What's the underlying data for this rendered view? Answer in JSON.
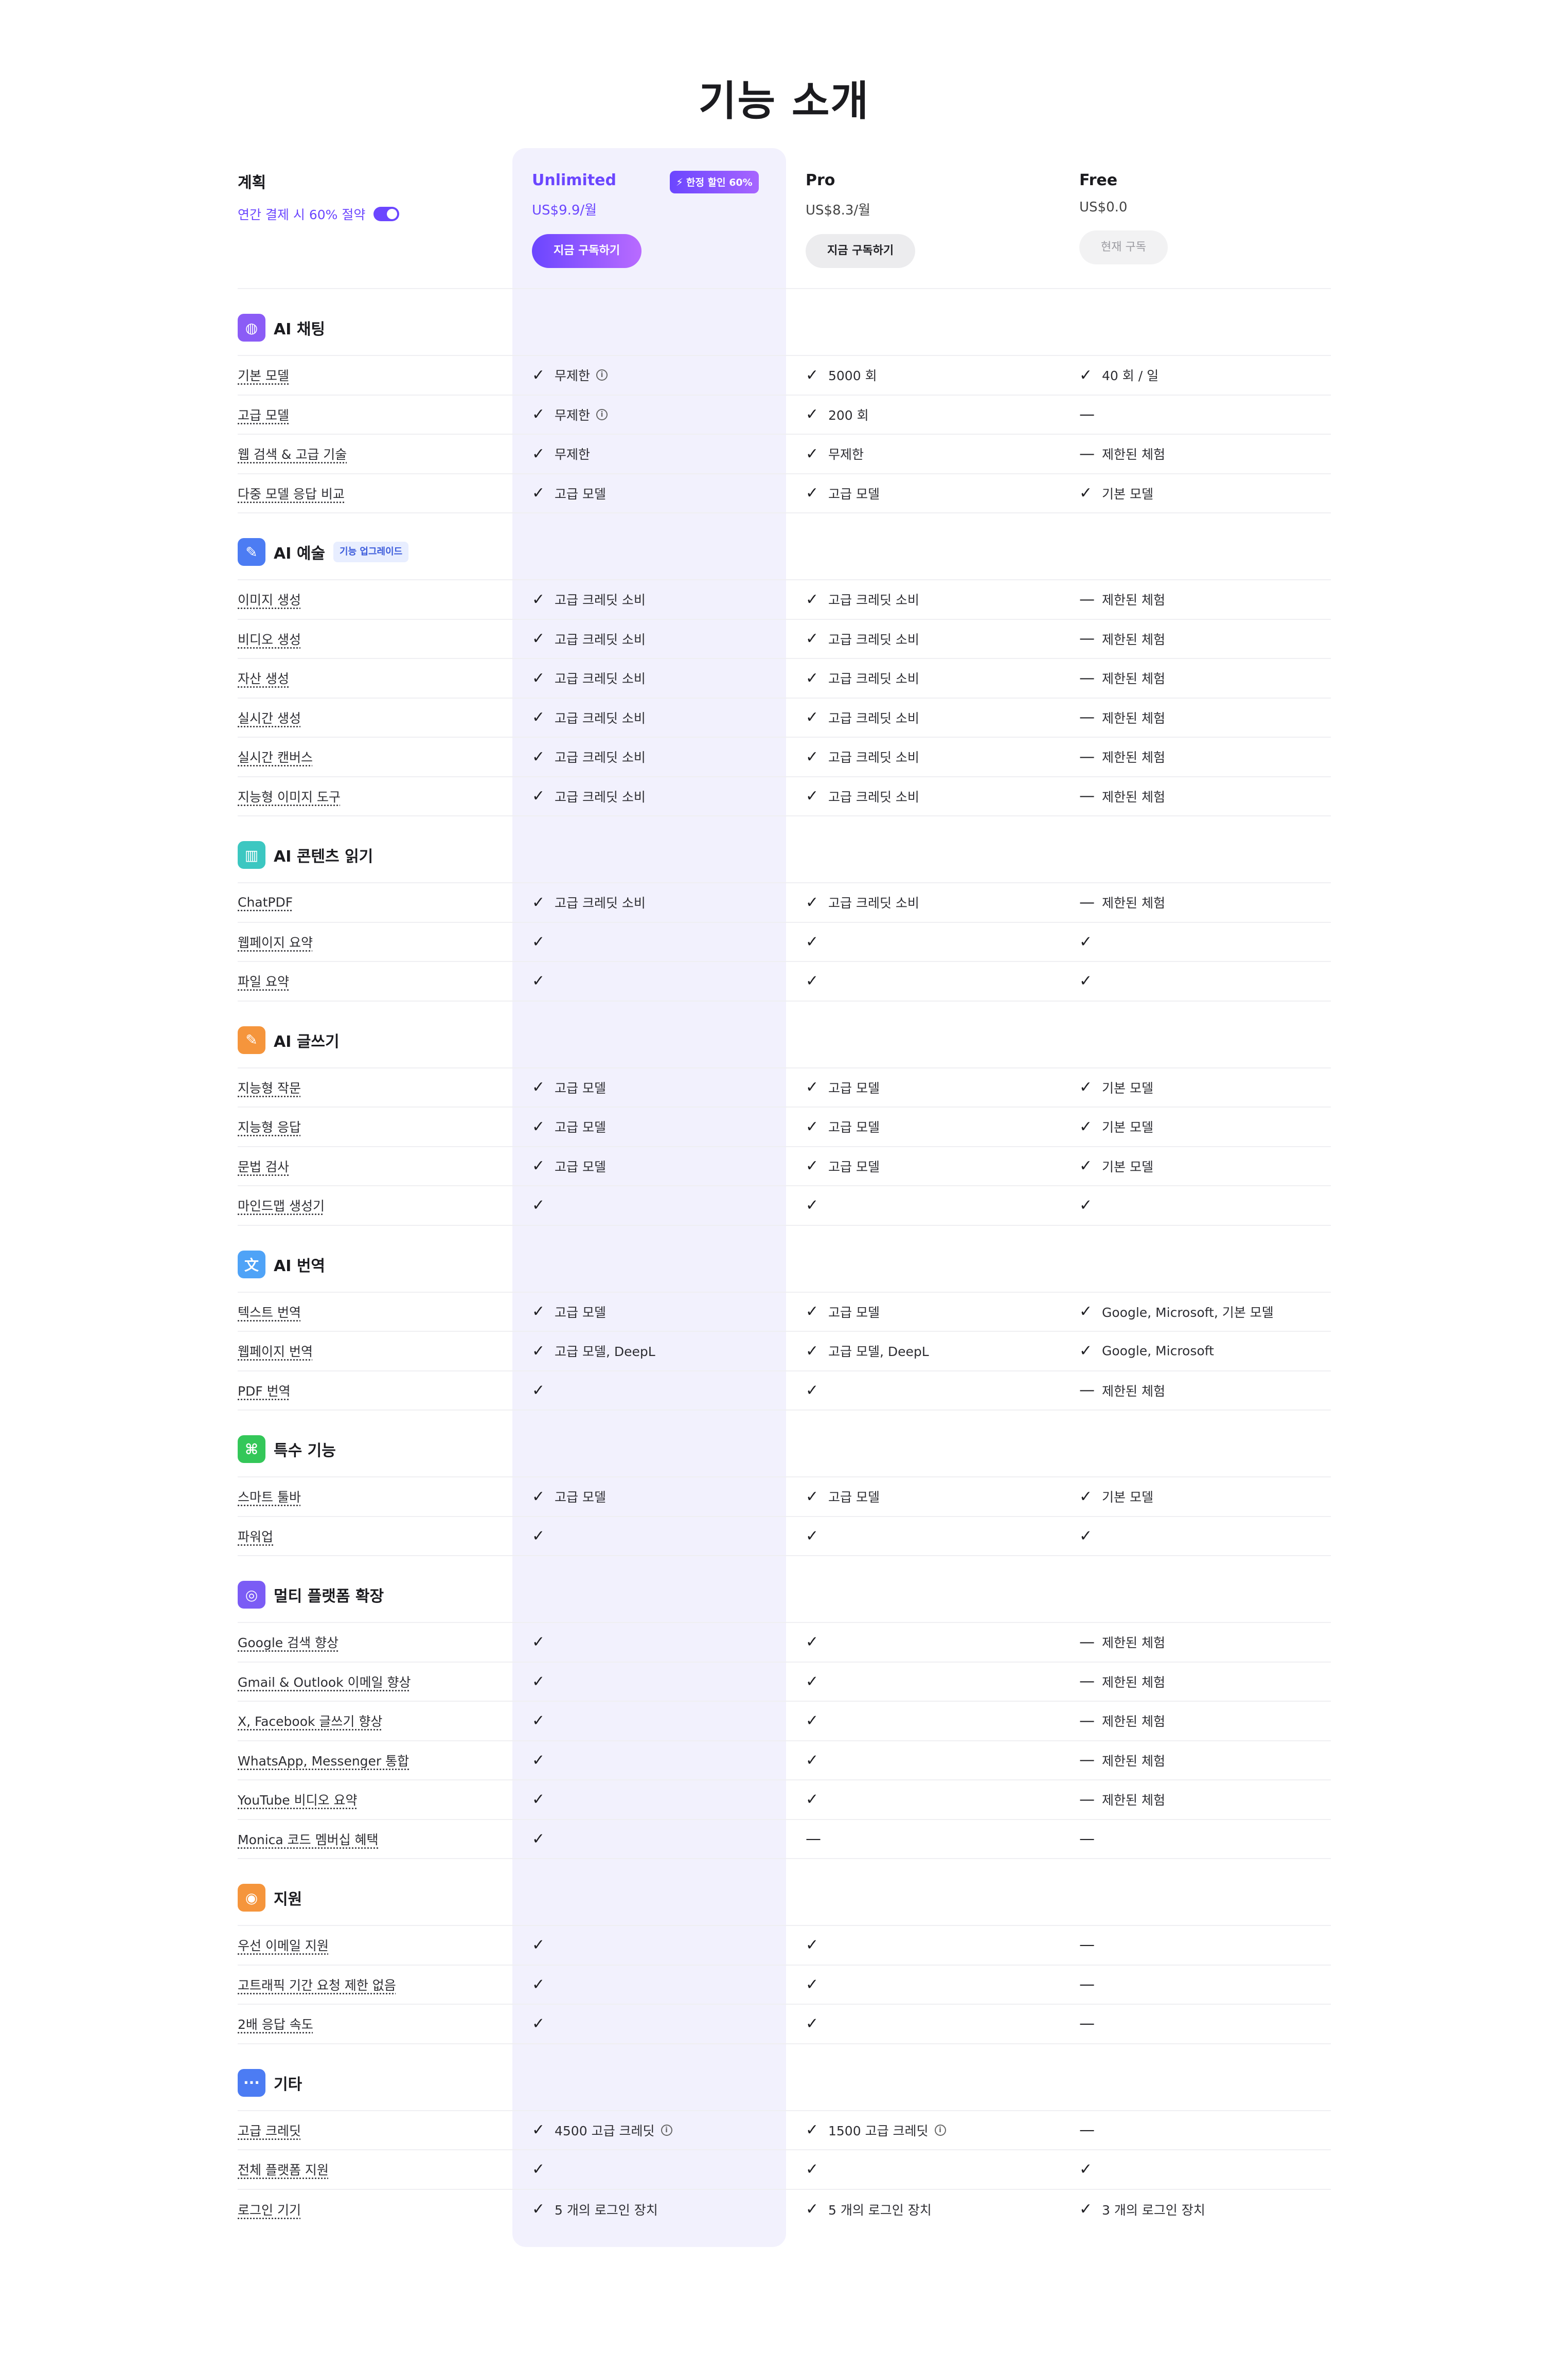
{
  "title": "기능 소개",
  "plans_header": {
    "label": "계획",
    "toggle_text": "연간 결제 시 60% 절약"
  },
  "columns": [
    {
      "name": "Unlimited",
      "price": "US$9.9/월",
      "button": "지금 구독하기",
      "badge": "한정 할인 60%"
    },
    {
      "name": "Pro",
      "price": "US$8.3/월",
      "button": "지금 구독하기"
    },
    {
      "name": "Free",
      "price": "US$0.0",
      "button": "현재 구독"
    }
  ],
  "colors": {
    "accent": "#6b46ff",
    "highlight_bg": "#f2f1fd"
  },
  "sections": [
    {
      "title": "AI 채팅",
      "icon": "chat-icon",
      "icon_color": "#8b5cf6",
      "icon_glyph": "◍",
      "rows": [
        {
          "feature": "기본 모델",
          "cells": [
            {
              "mark": "check",
              "text": "무제한",
              "info": true
            },
            {
              "mark": "check",
              "text": "5000 회"
            },
            {
              "mark": "check",
              "text": "40 회 / 일"
            }
          ]
        },
        {
          "feature": "고급 모델",
          "cells": [
            {
              "mark": "check",
              "text": "무제한",
              "info": true
            },
            {
              "mark": "check",
              "text": "200 회"
            },
            {
              "mark": "dash",
              "text": ""
            }
          ]
        },
        {
          "feature": "웹 검색 & 고급 기술",
          "cells": [
            {
              "mark": "check",
              "text": "무제한"
            },
            {
              "mark": "check",
              "text": "무제한"
            },
            {
              "mark": "dash",
              "text": "제한된 체험"
            }
          ]
        },
        {
          "feature": "다중 모델 응답 비교",
          "cells": [
            {
              "mark": "check",
              "text": "고급 모델"
            },
            {
              "mark": "check",
              "text": "고급 모델"
            },
            {
              "mark": "check",
              "text": "기본 모델"
            }
          ]
        }
      ]
    },
    {
      "title": "AI 예술",
      "icon": "brush-icon",
      "icon_color": "#4c7cf3",
      "icon_glyph": "✎",
      "badge": "기능 업그레이드",
      "rows": [
        {
          "feature": "이미지 생성",
          "cells": [
            {
              "mark": "check",
              "text": "고급 크레딧 소비"
            },
            {
              "mark": "check",
              "text": "고급 크레딧 소비"
            },
            {
              "mark": "dash",
              "text": "제한된 체험"
            }
          ]
        },
        {
          "feature": "비디오 생성",
          "cells": [
            {
              "mark": "check",
              "text": "고급 크레딧 소비"
            },
            {
              "mark": "check",
              "text": "고급 크레딧 소비"
            },
            {
              "mark": "dash",
              "text": "제한된 체험"
            }
          ]
        },
        {
          "feature": "자산 생성",
          "cells": [
            {
              "mark": "check",
              "text": "고급 크레딧 소비"
            },
            {
              "mark": "check",
              "text": "고급 크레딧 소비"
            },
            {
              "mark": "dash",
              "text": "제한된 체험"
            }
          ]
        },
        {
          "feature": "실시간 생성",
          "cells": [
            {
              "mark": "check",
              "text": "고급 크레딧 소비"
            },
            {
              "mark": "check",
              "text": "고급 크레딧 소비"
            },
            {
              "mark": "dash",
              "text": "제한된 체험"
            }
          ]
        },
        {
          "feature": "실시간 캔버스",
          "cells": [
            {
              "mark": "check",
              "text": "고급 크레딧 소비"
            },
            {
              "mark": "check",
              "text": "고급 크레딧 소비"
            },
            {
              "mark": "dash",
              "text": "제한된 체험"
            }
          ]
        },
        {
          "feature": "지능형 이미지 도구",
          "cells": [
            {
              "mark": "check",
              "text": "고급 크레딧 소비"
            },
            {
              "mark": "check",
              "text": "고급 크레딧 소비"
            },
            {
              "mark": "dash",
              "text": "제한된 체험"
            }
          ]
        }
      ]
    },
    {
      "title": "AI 콘텐츠 읽기",
      "icon": "book-icon",
      "icon_color": "#3cc7c1",
      "icon_glyph": "▥",
      "rows": [
        {
          "feature": "ChatPDF",
          "cells": [
            {
              "mark": "check",
              "text": "고급 크레딧 소비"
            },
            {
              "mark": "check",
              "text": "고급 크레딧 소비"
            },
            {
              "mark": "dash",
              "text": "제한된 체험"
            }
          ]
        },
        {
          "feature": "웹페이지 요약",
          "cells": [
            {
              "mark": "check",
              "text": ""
            },
            {
              "mark": "check",
              "text": ""
            },
            {
              "mark": "check",
              "text": ""
            }
          ]
        },
        {
          "feature": "파일 요약",
          "cells": [
            {
              "mark": "check",
              "text": ""
            },
            {
              "mark": "check",
              "text": ""
            },
            {
              "mark": "check",
              "text": ""
            }
          ]
        }
      ]
    },
    {
      "title": "AI 글쓰기",
      "icon": "pen-icon",
      "icon_color": "#f5953c",
      "icon_glyph": "✎",
      "rows": [
        {
          "feature": "지능형 작문",
          "cells": [
            {
              "mark": "check",
              "text": "고급 모델"
            },
            {
              "mark": "check",
              "text": "고급 모델"
            },
            {
              "mark": "check",
              "text": "기본 모델"
            }
          ]
        },
        {
          "feature": "지능형 응답",
          "cells": [
            {
              "mark": "check",
              "text": "고급 모델"
            },
            {
              "mark": "check",
              "text": "고급 모델"
            },
            {
              "mark": "check",
              "text": "기본 모델"
            }
          ]
        },
        {
          "feature": "문법 검사",
          "cells": [
            {
              "mark": "check",
              "text": "고급 모델"
            },
            {
              "mark": "check",
              "text": "고급 모델"
            },
            {
              "mark": "check",
              "text": "기본 모델"
            }
          ]
        },
        {
          "feature": "마인드맵 생성기",
          "cells": [
            {
              "mark": "check",
              "text": ""
            },
            {
              "mark": "check",
              "text": ""
            },
            {
              "mark": "check",
              "text": ""
            }
          ]
        }
      ]
    },
    {
      "title": "AI 번역",
      "icon": "translate-icon",
      "icon_color": "#4fa3f7",
      "icon_glyph": "文",
      "rows": [
        {
          "feature": "텍스트 번역",
          "cells": [
            {
              "mark": "check",
              "text": "고급 모델"
            },
            {
              "mark": "check",
              "text": "고급 모델"
            },
            {
              "mark": "check",
              "text": "Google, Microsoft, 기본 모델"
            }
          ]
        },
        {
          "feature": "웹페이지 번역",
          "cells": [
            {
              "mark": "check",
              "text": "고급 모델, DeepL"
            },
            {
              "mark": "check",
              "text": "고급 모델, DeepL"
            },
            {
              "mark": "check",
              "text": "Google, Microsoft"
            }
          ]
        },
        {
          "feature": "PDF 번역",
          "cells": [
            {
              "mark": "check",
              "text": ""
            },
            {
              "mark": "check",
              "text": ""
            },
            {
              "mark": "dash",
              "text": "제한된 체험"
            }
          ]
        }
      ]
    },
    {
      "title": "특수 기능",
      "icon": "command-icon",
      "icon_color": "#34c759",
      "icon_glyph": "⌘",
      "rows": [
        {
          "feature": "스마트 툴바",
          "cells": [
            {
              "mark": "check",
              "text": "고급 모델"
            },
            {
              "mark": "check",
              "text": "고급 모델"
            },
            {
              "mark": "check",
              "text": "기본 모델"
            }
          ]
        },
        {
          "feature": "파워업",
          "cells": [
            {
              "mark": "check",
              "text": ""
            },
            {
              "mark": "check",
              "text": ""
            },
            {
              "mark": "check",
              "text": ""
            }
          ]
        }
      ]
    },
    {
      "title": "멀티 플랫폼 확장",
      "icon": "planet-icon",
      "icon_color": "#7b5cf5",
      "icon_glyph": "◎",
      "rows": [
        {
          "feature": "Google 검색 향상",
          "cells": [
            {
              "mark": "check",
              "text": ""
            },
            {
              "mark": "check",
              "text": ""
            },
            {
              "mark": "dash",
              "text": "제한된 체험"
            }
          ]
        },
        {
          "feature": "Gmail & Outlook 이메일 향상",
          "cells": [
            {
              "mark": "check",
              "text": ""
            },
            {
              "mark": "check",
              "text": ""
            },
            {
              "mark": "dash",
              "text": "제한된 체험"
            }
          ]
        },
        {
          "feature": "X, Facebook 글쓰기 향상",
          "cells": [
            {
              "mark": "check",
              "text": ""
            },
            {
              "mark": "check",
              "text": ""
            },
            {
              "mark": "dash",
              "text": "제한된 체험"
            }
          ]
        },
        {
          "feature": "WhatsApp, Messenger 통합",
          "cells": [
            {
              "mark": "check",
              "text": ""
            },
            {
              "mark": "check",
              "text": ""
            },
            {
              "mark": "dash",
              "text": "제한된 체험"
            }
          ]
        },
        {
          "feature": "YouTube 비디오 요약",
          "cells": [
            {
              "mark": "check",
              "text": ""
            },
            {
              "mark": "check",
              "text": ""
            },
            {
              "mark": "dash",
              "text": "제한된 체험"
            }
          ]
        },
        {
          "feature": "Monica 코드 멤버십 혜택",
          "cells": [
            {
              "mark": "check",
              "text": ""
            },
            {
              "mark": "dash",
              "text": ""
            },
            {
              "mark": "dash",
              "text": ""
            }
          ]
        }
      ]
    },
    {
      "title": "지원",
      "icon": "support-icon",
      "icon_color": "#f5953c",
      "icon_glyph": "◉",
      "rows": [
        {
          "feature": "우선 이메일 지원",
          "cells": [
            {
              "mark": "check",
              "text": ""
            },
            {
              "mark": "check",
              "text": ""
            },
            {
              "mark": "dash",
              "text": ""
            }
          ]
        },
        {
          "feature": "고트래픽 기간 요청 제한 없음",
          "cells": [
            {
              "mark": "check",
              "text": ""
            },
            {
              "mark": "check",
              "text": ""
            },
            {
              "mark": "dash",
              "text": ""
            }
          ]
        },
        {
          "feature": "2배 응답 속도",
          "cells": [
            {
              "mark": "check",
              "text": ""
            },
            {
              "mark": "check",
              "text": ""
            },
            {
              "mark": "dash",
              "text": ""
            }
          ]
        }
      ]
    },
    {
      "title": "기타",
      "icon": "more-icon",
      "icon_color": "#4c7cf3",
      "icon_glyph": "···",
      "rows": [
        {
          "feature": "고급 크레딧",
          "cells": [
            {
              "mark": "check",
              "text": "4500 고급 크레딧",
              "info": true
            },
            {
              "mark": "check",
              "text": "1500 고급 크레딧",
              "info": true
            },
            {
              "mark": "dash",
              "text": ""
            }
          ]
        },
        {
          "feature": "전체 플랫폼 지원",
          "cells": [
            {
              "mark": "check",
              "text": ""
            },
            {
              "mark": "check",
              "text": ""
            },
            {
              "mark": "check",
              "text": ""
            }
          ]
        },
        {
          "feature": "로그인 기기",
          "cells": [
            {
              "mark": "check",
              "text": "5 개의 로그인 장치"
            },
            {
              "mark": "check",
              "text": "5 개의 로그인 장치"
            },
            {
              "mark": "check",
              "text": "3 개의 로그인 장치"
            }
          ]
        }
      ]
    }
  ]
}
